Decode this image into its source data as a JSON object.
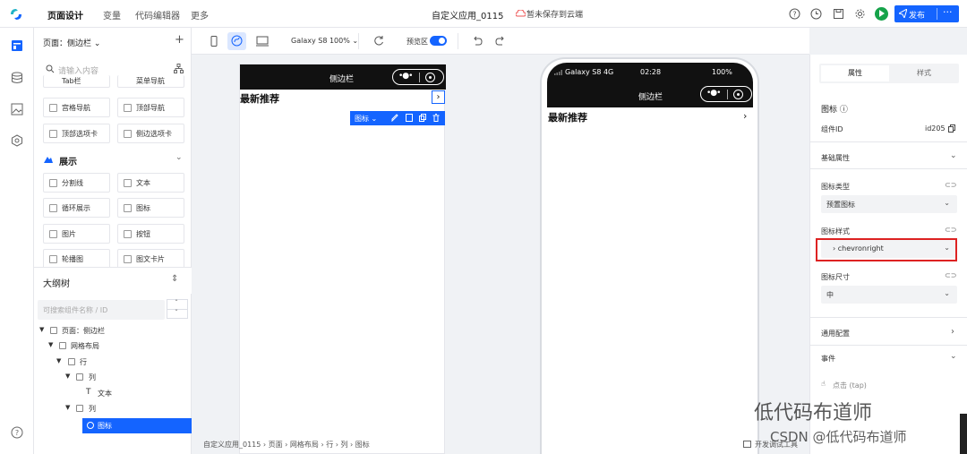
{
  "topbar": {
    "nav": [
      "页面设计",
      "变量",
      "代码编辑器",
      "更多"
    ],
    "app_title": "自定义应用_0115",
    "save_status": "暂未保存到云端",
    "publish_label": "发布",
    "more_label": "···"
  },
  "leftpanel": {
    "page_select": "页面：侧边栏 ⌄",
    "add_page": "+",
    "search_placeholder": "请输入内容",
    "components_top": [
      "Tab栏",
      "菜单导航",
      "宫格导航",
      "顶部导航",
      "顶部选项卡",
      "侧边选项卡"
    ],
    "section_display": "展示",
    "components_display": [
      "分割线",
      "文本",
      "循环展示",
      "图标",
      "图片",
      "按钮",
      "轮播图",
      "图文卡片"
    ],
    "outline_title": "大纲树",
    "outline_search_placeholder": "可搜索组件名称 / ID",
    "tree": [
      {
        "label": "页面：侧边栏",
        "level": 0
      },
      {
        "label": "网格布局",
        "level": 1
      },
      {
        "label": "行",
        "level": 2
      },
      {
        "label": "列",
        "level": 3
      },
      {
        "label": "文本",
        "level": 4
      },
      {
        "label": "列",
        "level": 3
      },
      {
        "label": "图标",
        "level": 4
      }
    ]
  },
  "canvas_toolbar": {
    "device": "Galaxy S8 100% ⌄",
    "preview_label": "预览区"
  },
  "design_frame": {
    "nav_title": "侧边栏",
    "heading": "最新推荐",
    "selected_name": "图标 ⌄"
  },
  "phone": {
    "carrier": "Galaxy S8  4G",
    "time": "02:28",
    "battery": "100%",
    "nav_title": "侧边栏",
    "heading": "最新推荐",
    "chevron": "›"
  },
  "breadcrumb": "自定义应用_0115 › 页面 › 网格布局 › 行 › 列 › 图标",
  "dev_debug": "开发调试工具",
  "rightpanel": {
    "tab_attr": "属性",
    "tab_style": "样式",
    "component_title": "图标 ⓘ",
    "component_id_label": "组件ID",
    "component_id": "id205",
    "basic_props": "基础属性",
    "icon_type_label": "图标类型",
    "icon_type_value": "预置图标",
    "icon_style_label": "图标样式",
    "icon_style_value": "›  chevronright",
    "icon_size_label": "图标尺寸",
    "icon_size_value": "中",
    "common_config": "通用配置",
    "events": "事件",
    "event_tap": "点击 (tap)"
  },
  "watermark": "低代码布道师",
  "watermark_csdn": "CSDN @低代码布道师"
}
